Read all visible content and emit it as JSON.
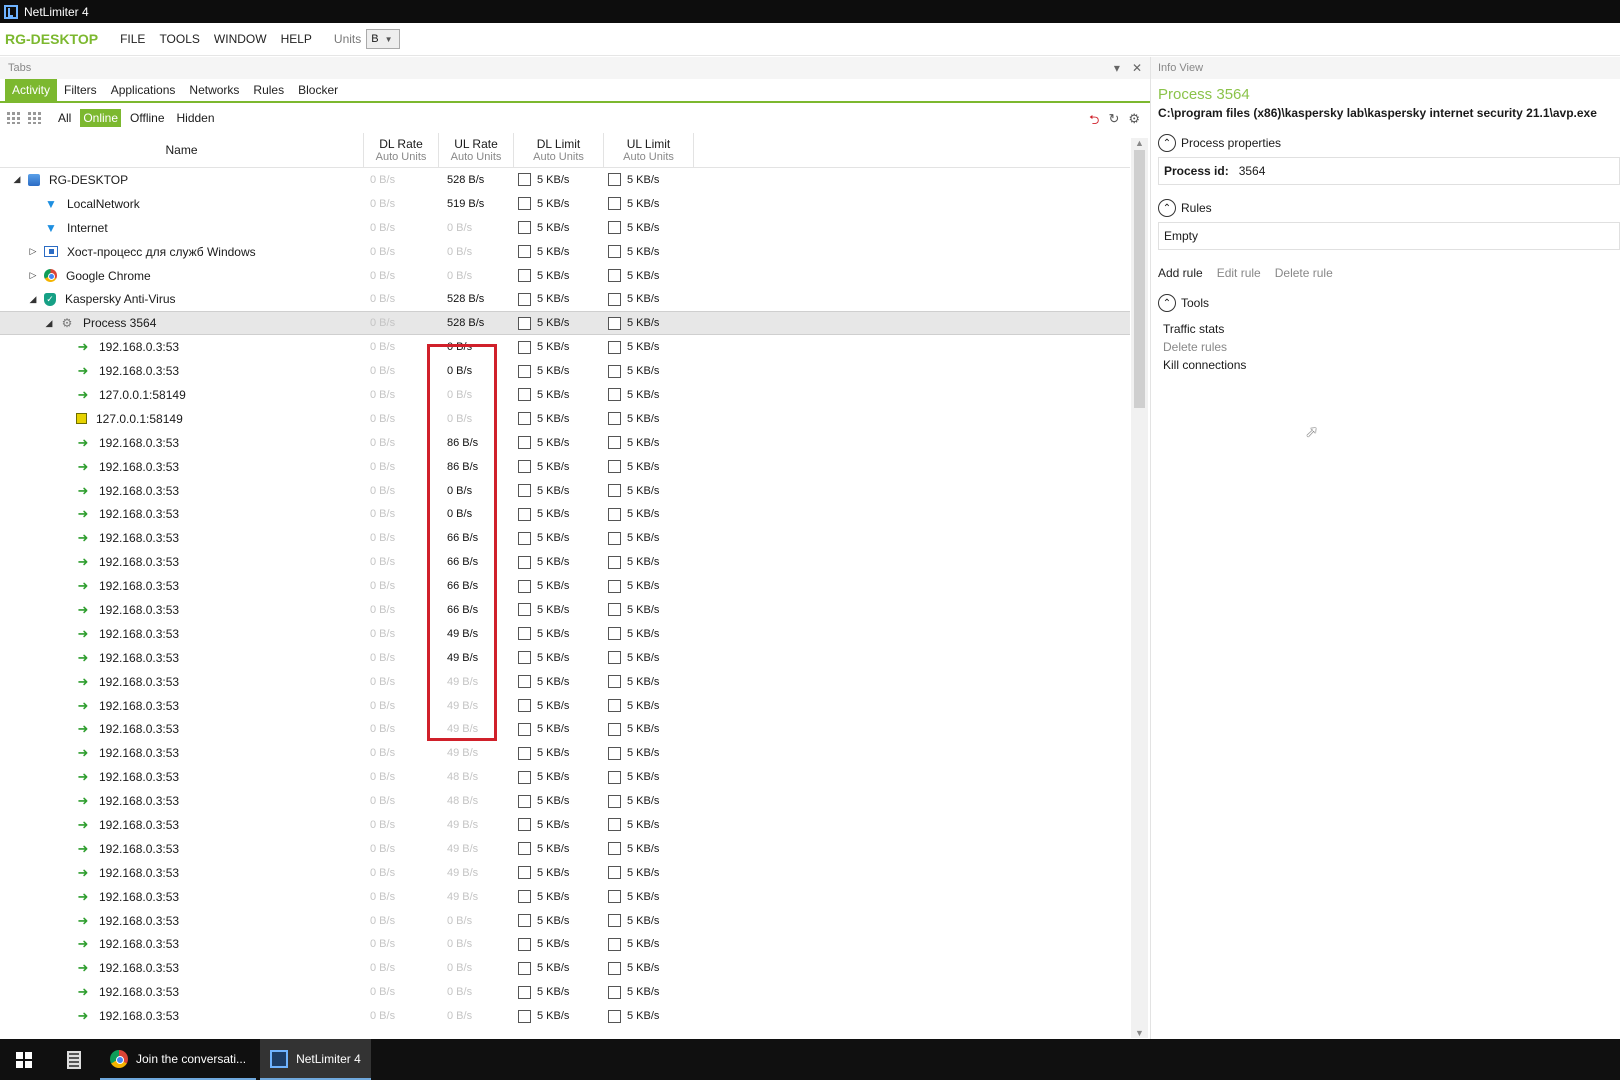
{
  "window": {
    "title": "NetLimiter 4"
  },
  "menu": {
    "brand": "RG-DESKTOP",
    "items": [
      "FILE",
      "TOOLS",
      "WINDOW",
      "HELP"
    ],
    "units_label": "Units",
    "units_value": "B"
  },
  "tabs_panel": {
    "title": "Tabs",
    "tabs": [
      "Activity",
      "Filters",
      "Applications",
      "Networks",
      "Rules",
      "Blocker"
    ],
    "active_tab": "Activity",
    "filters": [
      "All",
      "Online",
      "Offline",
      "Hidden"
    ],
    "active_filter": "Online"
  },
  "grid": {
    "columns": [
      {
        "title": "Name",
        "sub": ""
      },
      {
        "title": "DL Rate",
        "sub": "Auto Units"
      },
      {
        "title": "UL Rate",
        "sub": "Auto Units"
      },
      {
        "title": "DL Limit",
        "sub": "Auto Units"
      },
      {
        "title": "UL Limit",
        "sub": "Auto Units"
      }
    ],
    "limit_value": "5 KB/s",
    "rows": [
      {
        "name": "RG-DESKTOP",
        "level": 0,
        "expander": "◢",
        "icon": "computer-icon",
        "dl": "0 B/s",
        "ul": "528 B/s",
        "ul_dim": false
      },
      {
        "name": "LocalNetwork",
        "level": 1,
        "expander": "",
        "icon": "filter-icon",
        "dl": "0 B/s",
        "ul": "519 B/s",
        "ul_dim": false
      },
      {
        "name": "Internet",
        "level": 1,
        "expander": "",
        "icon": "filter-icon",
        "dl": "0 B/s",
        "ul": "0 B/s",
        "ul_dim": true
      },
      {
        "name": "Хост-процесс для служб Windows",
        "level": 1,
        "expander": "▷",
        "icon": "windows-app-icon",
        "dl": "0 B/s",
        "ul": "0 B/s",
        "ul_dim": true
      },
      {
        "name": "Google Chrome",
        "level": 1,
        "expander": "▷",
        "icon": "chrome-icon",
        "dl": "0 B/s",
        "ul": "0 B/s",
        "ul_dim": true
      },
      {
        "name": "Kaspersky Anti-Virus",
        "level": 1,
        "expander": "◢",
        "icon": "kaspersky-shield-icon",
        "dl": "0 B/s",
        "ul": "528 B/s",
        "ul_dim": false
      },
      {
        "name": "Process 3564",
        "level": 2,
        "expander": "◢",
        "icon": "process-icon",
        "dl": "0 B/s",
        "ul": "528 B/s",
        "ul_dim": false,
        "selected": true
      },
      {
        "name": "192.168.0.3:53",
        "level": 3,
        "expander": "",
        "icon": "connection-arrow-icon",
        "dl": "0 B/s",
        "ul": "0 B/s",
        "ul_dim": false
      },
      {
        "name": "192.168.0.3:53",
        "level": 3,
        "expander": "",
        "icon": "connection-arrow-icon",
        "dl": "0 B/s",
        "ul": "0 B/s",
        "ul_dim": false
      },
      {
        "name": "127.0.0.1:58149",
        "level": 3,
        "expander": "",
        "icon": "connection-arrow-icon",
        "dl": "0 B/s",
        "ul": "0 B/s",
        "ul_dim": true
      },
      {
        "name": "127.0.0.1:58149",
        "level": 3,
        "expander": "",
        "icon": "connection-yellow-icon",
        "dl": "0 B/s",
        "ul": "0 B/s",
        "ul_dim": true
      },
      {
        "name": "192.168.0.3:53",
        "level": 3,
        "expander": "",
        "icon": "connection-arrow-icon",
        "dl": "0 B/s",
        "ul": "86 B/s",
        "ul_dim": false
      },
      {
        "name": "192.168.0.3:53",
        "level": 3,
        "expander": "",
        "icon": "connection-arrow-icon",
        "dl": "0 B/s",
        "ul": "86 B/s",
        "ul_dim": false
      },
      {
        "name": "192.168.0.3:53",
        "level": 3,
        "expander": "",
        "icon": "connection-arrow-icon",
        "dl": "0 B/s",
        "ul": "0 B/s",
        "ul_dim": false
      },
      {
        "name": "192.168.0.3:53",
        "level": 3,
        "expander": "",
        "icon": "connection-arrow-icon",
        "dl": "0 B/s",
        "ul": "0 B/s",
        "ul_dim": false
      },
      {
        "name": "192.168.0.3:53",
        "level": 3,
        "expander": "",
        "icon": "connection-arrow-icon",
        "dl": "0 B/s",
        "ul": "66 B/s",
        "ul_dim": false
      },
      {
        "name": "192.168.0.3:53",
        "level": 3,
        "expander": "",
        "icon": "connection-arrow-icon",
        "dl": "0 B/s",
        "ul": "66 B/s",
        "ul_dim": false
      },
      {
        "name": "192.168.0.3:53",
        "level": 3,
        "expander": "",
        "icon": "connection-arrow-icon",
        "dl": "0 B/s",
        "ul": "66 B/s",
        "ul_dim": false
      },
      {
        "name": "192.168.0.3:53",
        "level": 3,
        "expander": "",
        "icon": "connection-arrow-icon",
        "dl": "0 B/s",
        "ul": "66 B/s",
        "ul_dim": false
      },
      {
        "name": "192.168.0.3:53",
        "level": 3,
        "expander": "",
        "icon": "connection-arrow-icon",
        "dl": "0 B/s",
        "ul": "49 B/s",
        "ul_dim": false
      },
      {
        "name": "192.168.0.3:53",
        "level": 3,
        "expander": "",
        "icon": "connection-arrow-icon",
        "dl": "0 B/s",
        "ul": "49 B/s",
        "ul_dim": false
      },
      {
        "name": "192.168.0.3:53",
        "level": 3,
        "expander": "",
        "icon": "connection-arrow-icon",
        "dl": "0 B/s",
        "ul": "49 B/s",
        "ul_dim": true
      },
      {
        "name": "192.168.0.3:53",
        "level": 3,
        "expander": "",
        "icon": "connection-arrow-icon",
        "dl": "0 B/s",
        "ul": "49 B/s",
        "ul_dim": true
      },
      {
        "name": "192.168.0.3:53",
        "level": 3,
        "expander": "",
        "icon": "connection-arrow-icon",
        "dl": "0 B/s",
        "ul": "49 B/s",
        "ul_dim": true
      },
      {
        "name": "192.168.0.3:53",
        "level": 3,
        "expander": "",
        "icon": "connection-arrow-icon",
        "dl": "0 B/s",
        "ul": "49 B/s",
        "ul_dim": true
      },
      {
        "name": "192.168.0.3:53",
        "level": 3,
        "expander": "",
        "icon": "connection-arrow-icon",
        "dl": "0 B/s",
        "ul": "48 B/s",
        "ul_dim": true
      },
      {
        "name": "192.168.0.3:53",
        "level": 3,
        "expander": "",
        "icon": "connection-arrow-icon",
        "dl": "0 B/s",
        "ul": "48 B/s",
        "ul_dim": true
      },
      {
        "name": "192.168.0.3:53",
        "level": 3,
        "expander": "",
        "icon": "connection-arrow-icon",
        "dl": "0 B/s",
        "ul": "49 B/s",
        "ul_dim": true
      },
      {
        "name": "192.168.0.3:53",
        "level": 3,
        "expander": "",
        "icon": "connection-arrow-icon",
        "dl": "0 B/s",
        "ul": "49 B/s",
        "ul_dim": true
      },
      {
        "name": "192.168.0.3:53",
        "level": 3,
        "expander": "",
        "icon": "connection-arrow-icon",
        "dl": "0 B/s",
        "ul": "49 B/s",
        "ul_dim": true
      },
      {
        "name": "192.168.0.3:53",
        "level": 3,
        "expander": "",
        "icon": "connection-arrow-icon",
        "dl": "0 B/s",
        "ul": "49 B/s",
        "ul_dim": true
      },
      {
        "name": "192.168.0.3:53",
        "level": 3,
        "expander": "",
        "icon": "connection-arrow-icon",
        "dl": "0 B/s",
        "ul": "0 B/s",
        "ul_dim": true
      },
      {
        "name": "192.168.0.3:53",
        "level": 3,
        "expander": "",
        "icon": "connection-arrow-icon",
        "dl": "0 B/s",
        "ul": "0 B/s",
        "ul_dim": true
      },
      {
        "name": "192.168.0.3:53",
        "level": 3,
        "expander": "",
        "icon": "connection-arrow-icon",
        "dl": "0 B/s",
        "ul": "0 B/s",
        "ul_dim": true
      },
      {
        "name": "192.168.0.3:53",
        "level": 3,
        "expander": "",
        "icon": "connection-arrow-icon",
        "dl": "0 B/s",
        "ul": "0 B/s",
        "ul_dim": true
      },
      {
        "name": "192.168.0.3:53",
        "level": 3,
        "expander": "",
        "icon": "connection-arrow-icon",
        "dl": "0 B/s",
        "ul": "0 B/s",
        "ul_dim": true
      }
    ]
  },
  "info_view": {
    "title": "Info View",
    "process_title": "Process 3564",
    "path": "C:\\program files (x86)\\kaspersky lab\\kaspersky internet security 21.1\\avp.exe",
    "sections": {
      "process_properties": "Process properties",
      "rules": "Rules",
      "tools": "Tools"
    },
    "process_id_label": "Process id:",
    "process_id_value": "3564",
    "rules_value": "Empty",
    "rule_actions": [
      "Add rule",
      "Edit rule",
      "Delete rule"
    ],
    "tools": [
      "Traffic stats",
      "Delete rules",
      "Kill connections"
    ]
  },
  "taskbar": {
    "items": [
      {
        "label": "Join the conversati...",
        "icon": "chrome-icon",
        "active": false
      },
      {
        "label": "NetLimiter 4",
        "icon": "netlimiter-icon",
        "active": true
      }
    ]
  },
  "colors": {
    "accent": "#7cb82f",
    "highlight_box": "#d0202a",
    "dim_text": "#c4c4c4"
  }
}
